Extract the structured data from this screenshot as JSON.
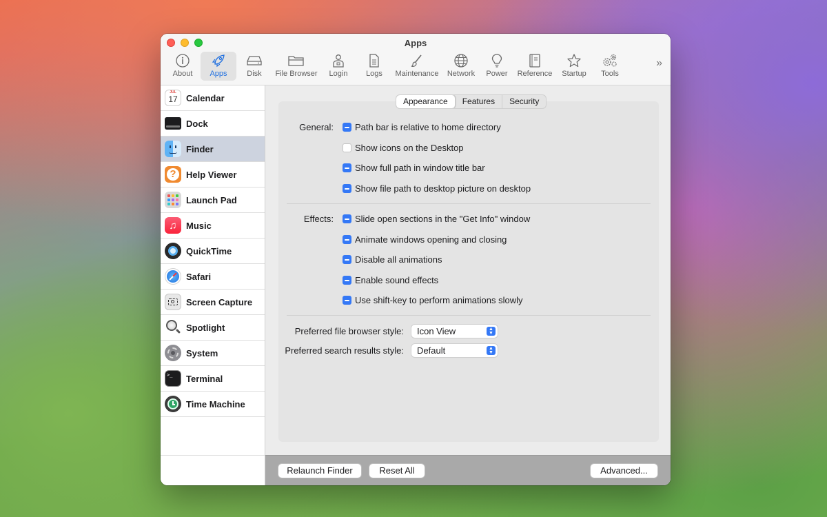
{
  "window": {
    "title": "Apps"
  },
  "toolbar": {
    "items": [
      {
        "label": "About",
        "icon": "info-icon"
      },
      {
        "label": "Apps",
        "icon": "rocket-icon",
        "active": true
      },
      {
        "label": "Disk",
        "icon": "disk-icon"
      },
      {
        "label": "File Browser",
        "icon": "folder-icon"
      },
      {
        "label": "Login",
        "icon": "login-icon"
      },
      {
        "label": "Logs",
        "icon": "document-icon"
      },
      {
        "label": "Maintenance",
        "icon": "brush-icon"
      },
      {
        "label": "Network",
        "icon": "globe-icon"
      },
      {
        "label": "Power",
        "icon": "lightbulb-icon"
      },
      {
        "label": "Reference",
        "icon": "book-icon"
      },
      {
        "label": "Startup",
        "icon": "star-icon"
      },
      {
        "label": "Tools",
        "icon": "gears-icon"
      }
    ],
    "overflow": "»"
  },
  "sidebar": {
    "items": [
      {
        "label": "Calendar",
        "icon": "calendar-icon",
        "badge_month": "JUL",
        "badge_day": "17"
      },
      {
        "label": "Dock",
        "icon": "dock-icon"
      },
      {
        "label": "Finder",
        "icon": "finder-icon",
        "selected": true
      },
      {
        "label": "Help Viewer",
        "icon": "help-icon",
        "glyph": "?"
      },
      {
        "label": "Launch Pad",
        "icon": "launchpad-icon"
      },
      {
        "label": "Music",
        "icon": "music-icon",
        "glyph": "♫"
      },
      {
        "label": "QuickTime",
        "icon": "quicktime-icon"
      },
      {
        "label": "Safari",
        "icon": "safari-icon"
      },
      {
        "label": "Screen Capture",
        "icon": "screenshot-icon"
      },
      {
        "label": "Spotlight",
        "icon": "spotlight-icon"
      },
      {
        "label": "System",
        "icon": "system-icon"
      },
      {
        "label": "Terminal",
        "icon": "terminal-icon",
        "glyph": ">_"
      },
      {
        "label": "Time Machine",
        "icon": "timemachine-icon"
      }
    ]
  },
  "tabs": [
    {
      "label": "Appearance",
      "active": true
    },
    {
      "label": "Features"
    },
    {
      "label": "Security"
    }
  ],
  "general": {
    "label": "General:",
    "options": [
      {
        "label": "Path bar is relative to home directory",
        "checked": true
      },
      {
        "label": "Show icons on the Desktop",
        "checked": false
      },
      {
        "label": "Show full path in window title bar",
        "checked": true
      },
      {
        "label": "Show file path to desktop picture on desktop",
        "checked": true
      }
    ]
  },
  "effects": {
    "label": "Effects:",
    "options": [
      {
        "label": "Slide open sections in the \"Get Info\" window",
        "checked": true
      },
      {
        "label": "Animate windows opening and closing",
        "checked": true
      },
      {
        "label": "Disable all animations",
        "checked": true
      },
      {
        "label": "Enable sound effects",
        "checked": true
      },
      {
        "label": "Use shift-key to perform animations slowly",
        "checked": true
      }
    ]
  },
  "prefs": {
    "browser_label": "Preferred file browser style:",
    "browser_value": "Icon View",
    "search_label": "Preferred search results style:",
    "search_value": "Default"
  },
  "footer": {
    "relaunch": "Relaunch Finder",
    "reset": "Reset All",
    "advanced": "Advanced..."
  },
  "colors": {
    "accent": "#3478f6",
    "selection": "#cdd3df"
  }
}
